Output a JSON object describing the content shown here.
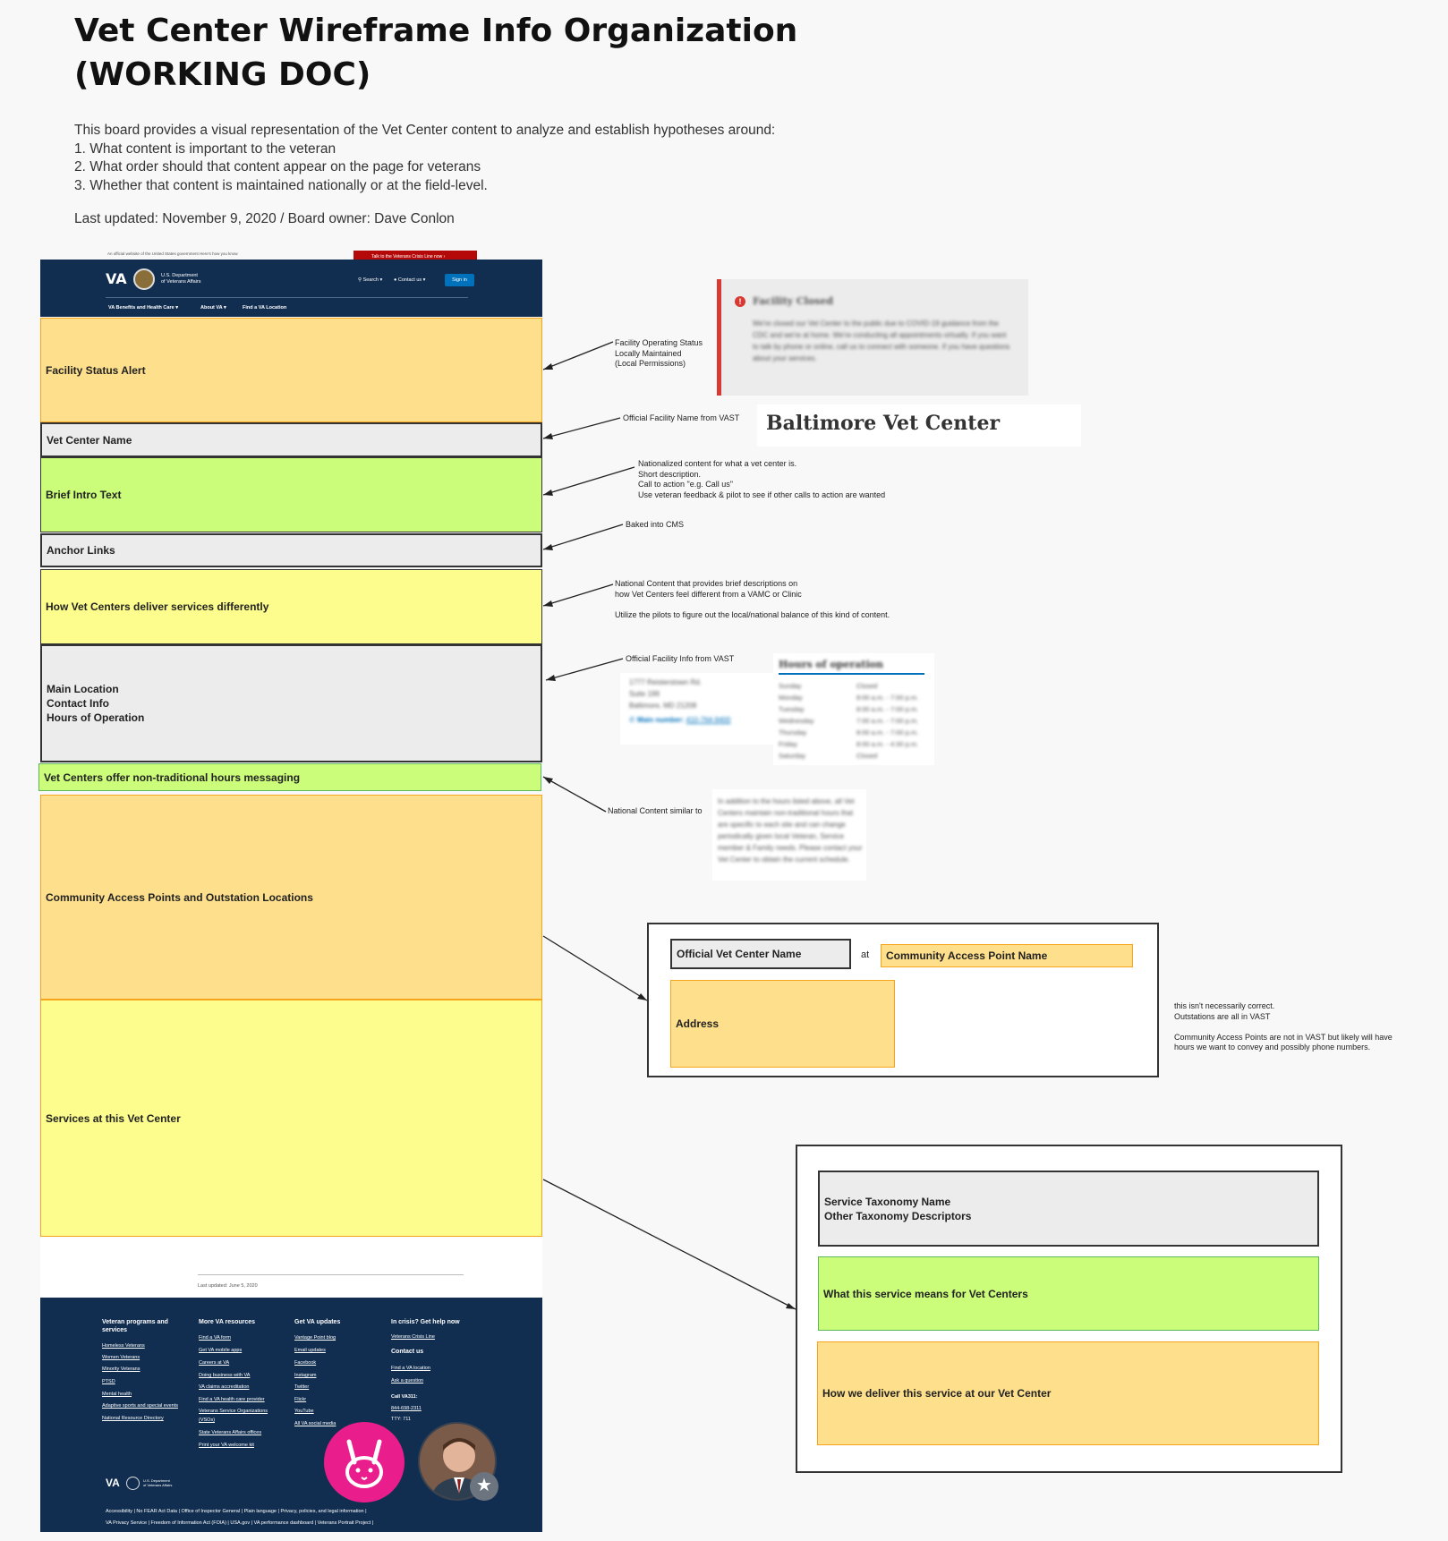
{
  "header": {
    "title_line1": "Vet Center Wireframe Info Organization",
    "title_line2": "(WORKING DOC)",
    "intro": "This board provides a visual representation of the Vet Center content to analyze and establish hypotheses around:",
    "points": [
      "1.  What content is important to the veteran",
      "2. What order should that content appear on the page for veterans",
      "3. Whether that content is maintained nationally or at the field-level."
    ],
    "last_updated": "Last updated: November 9, 2020 / Board owner: Dave Conlon"
  },
  "va_header": {
    "gov_banner": "An official website of the United States government  Here's how you know",
    "crisis_line": "Talk to the Veterans Crisis Line now",
    "logo": "VA",
    "dept": "U.S. Department\nof Veterans Affairs",
    "search": "Search",
    "contact": "Contact us",
    "sign_in": "Sign in",
    "nav": [
      "VA Benefits and Health Care",
      "About VA",
      "Find a VA Location"
    ]
  },
  "wireframe": {
    "facility_status": "Facility Status Alert",
    "vet_center_name": "Vet Center Name",
    "brief_intro": "Brief Intro Text",
    "anchor_links": "Anchor Links",
    "how_different": "How Vet Centers deliver services differently",
    "main_location": "Main Location\nContact Info\nHours of Operation",
    "non_traditional": "Vet Centers offer non-traditional hours messaging",
    "community_access": "Community Access Points and Outstation Locations",
    "services": "Services at this Vet Center"
  },
  "annotations": {
    "facility_status": "Facility Operating Status\nLocally Maintained\n(Local Permissions)",
    "facility_name": "Official Facility Name from VAST",
    "intro_text": "Nationalized content for what a vet center is.\nShort description.\nCall to action \"e.g. Call us\"\nUse veteran feedback & pilot to see if other calls to action are wanted",
    "anchor_links": "Baked into CMS",
    "how_different": "National Content that provides brief descriptions on\nhow Vet Centers feel different from a VAMC or Clinic\n\nUtilize the pilots to figure out the local/national balance of this kind of content.",
    "facility_info": "Official Facility Info from VAST",
    "non_traditional": "National Content similar to",
    "community_note": "this isn't necessarily correct.\nOutstations are all in VAST\n\nCommunity Access Points are not in VAST but likely will have\nhours we want to convey and possibly phone numbers."
  },
  "examples": {
    "facility_closed_title": "Facility Closed",
    "facility_closed_body": "We're closed our Vet Center to the public due to COVID-19 guidance from the CDC and we're at home. We're conducting all appointments virtually. If you want to talk by phone or online, call us to connect with someone. If you have questions about your services.",
    "baltimore_name": "Baltimore Vet Center",
    "address": "1777 Reisterstown Rd.\nSuite 199\nBaltimore, MD 21208",
    "main_number_label": "Main number:",
    "main_number": "410-764-9400",
    "hours_title": "Hours of operation",
    "hours": [
      {
        "day": "Sunday",
        "time": "Closed"
      },
      {
        "day": "Monday",
        "time": "8:00 a.m. - 7:00 p.m."
      },
      {
        "day": "Tuesday",
        "time": "8:00 a.m. - 7:00 p.m."
      },
      {
        "day": "Wednesday",
        "time": "7:00 a.m. - 7:00 p.m."
      },
      {
        "day": "Thursday",
        "time": "8:00 a.m. - 7:00 p.m."
      },
      {
        "day": "Friday",
        "time": "8:00 a.m. - 4:30 p.m."
      },
      {
        "day": "Saturday",
        "time": "Closed"
      }
    ],
    "non_traditional_body": "In addition to the hours listed above, all Vet Centers maintain non-traditional hours that are specific to each site and can change periodically given local Veteran, Service member & Family needs. Please contact your Vet Center to obtain the current schedule."
  },
  "community_box": {
    "official_name": "Official Vet Center Name",
    "at": "at",
    "community_point": "Community Access Point Name",
    "address": "Address"
  },
  "services_box": {
    "taxonomy": "Service Taxonomy Name\nOther Taxonomy Descriptors",
    "means": "What this service means for Vet Centers",
    "deliver": "How we deliver this service at our Vet Center"
  },
  "va_footer": {
    "last_updated": "Last updated: June 5, 2020",
    "col1_head": "Veteran programs and\nservices",
    "col1": [
      "Homeless Veterans",
      "Women Veterans",
      "Minority Veterans",
      "PTSD",
      "Mental health",
      "Adaptive sports and special events",
      "National Resource Directory"
    ],
    "col2_head": "More VA resources",
    "col2": [
      "Find a VA form",
      "Get VA mobile apps",
      "Careers at VA",
      "Doing business with VA",
      "VA claims accreditation",
      "Find a VA health care provider",
      "Veterans Service Organizations",
      "(VSOs)",
      "State Veterans Affairs offices",
      "Print your VA welcome kit"
    ],
    "col3_head": "Get VA updates",
    "col3": [
      "Vantage Point blog",
      "Email updates",
      "Facebook",
      "Instagram",
      "Twitter",
      "Flickr",
      "YouTube",
      "All VA social media"
    ],
    "col4_head": "In crisis? Get help now",
    "col4_link": "Veterans Crisis Line",
    "contact_head": "Contact us",
    "contact_links": [
      "Find a VA location",
      "Ask a question"
    ],
    "call_label": "Call VA311:",
    "call_numbers": [
      "844-698-2311",
      "TTY: 711"
    ],
    "logo": "VA",
    "dept": "U.S. Department\nof Veterans Affairs",
    "bottom1": "Accessibility  |  No FEAR Act Data  |  Office of Inspector General  |  Plain language  |  Privacy, policies, and legal information  |",
    "bottom2": "VA Privacy Service  |  Freedom of Information Act (FOIA)  |  USA.gov  |  VA performance dashboard  |  Veterans Portrait Project  |"
  },
  "colors": {
    "orange": "#fedf8c",
    "green": "#cbfd7a",
    "yellow": "#fdfd8e",
    "gray": "#ececec",
    "va_navy": "#112e51",
    "alert_red": "#d83933",
    "avatar_pink": "#e91e8c"
  },
  "icons": [
    "flag-icon",
    "chevron-right-icon",
    "search-icon",
    "chevron-down-icon",
    "alert-icon",
    "phone-icon",
    "bunny-avatar-icon",
    "star-badge-icon"
  ]
}
